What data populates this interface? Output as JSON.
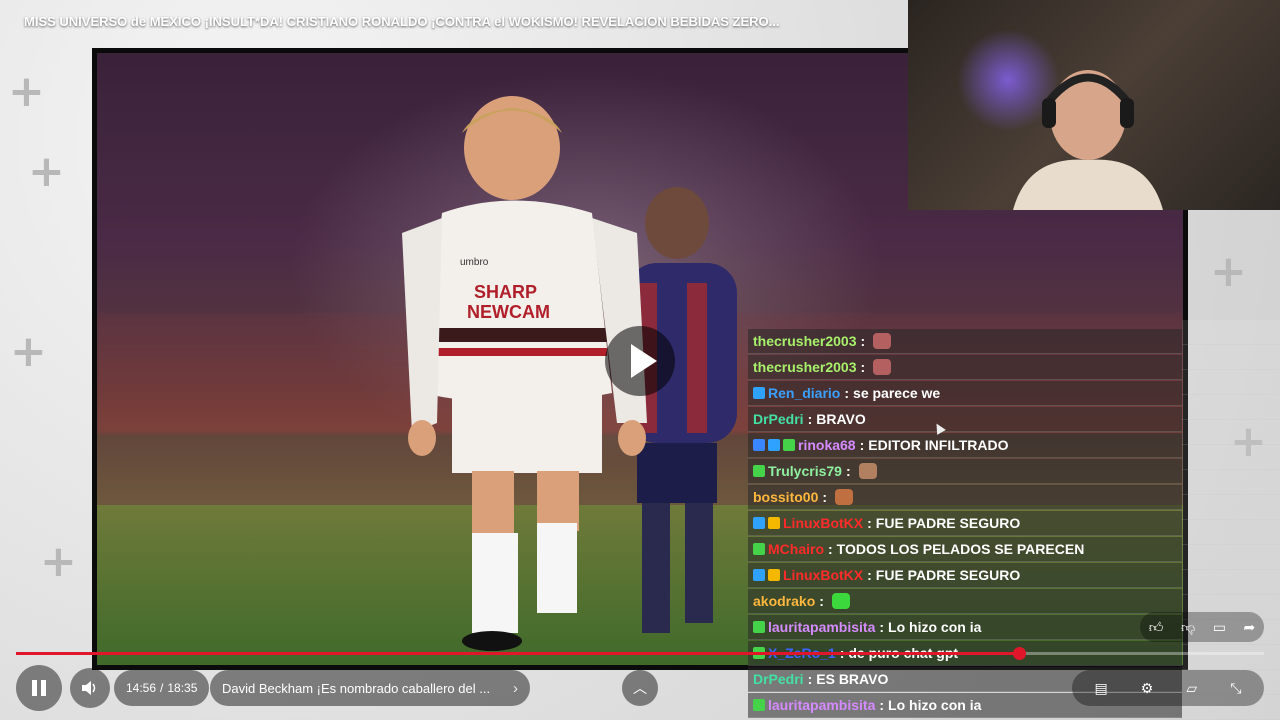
{
  "video": {
    "title": "MISS UNIVERSO de MEXICO ¡INSULT*DA! CRISTIANO RONALDO ¡CONTRA el WOKISMO! REVELACION BEBIDAS ZERO...",
    "kit_sponsor_line1": "SHARP",
    "kit_sponsor_line2": "NEWCAM",
    "kit_brand": "umbro"
  },
  "chat": {
    "messages": [
      {
        "user": "thecrusher2003",
        "user_color": "#a6f06a",
        "text": "",
        "badges": [],
        "emote": "#b46060"
      },
      {
        "user": "thecrusher2003",
        "user_color": "#a6f06a",
        "text": "",
        "badges": [],
        "emote": "#b46060"
      },
      {
        "user": "Ren_diario",
        "user_color": "#3aa0ff",
        "text": "se parece we",
        "badges": [
          "#2fa2ff"
        ],
        "emote": ""
      },
      {
        "user": "DrPedri",
        "user_color": "#43e0a4",
        "text": "BRAVO",
        "badges": [],
        "emote": ""
      },
      {
        "user": "rinoka68",
        "user_color": "#d58bff",
        "text": "EDITOR INFILTRADO",
        "badges": [
          "#3a86ff",
          "#2fa2ff",
          "#45d34a"
        ],
        "emote": ""
      },
      {
        "user": "Trulycris79",
        "user_color": "#8ef0a0",
        "text": "",
        "badges": [
          "#45d34a"
        ],
        "emote": "#b08060"
      },
      {
        "user": "bossito00",
        "user_color": "#ffb83d",
        "text": "",
        "badges": [],
        "emote": "#c07040"
      },
      {
        "user": "LinuxBotKX",
        "user_color": "#ff2a2a",
        "text": "FUE PADRE SEGURO",
        "badges": [
          "#2fa2ff",
          "#f4b800"
        ],
        "emote": ""
      },
      {
        "user": "MChairo",
        "user_color": "#ff2a2a",
        "text": "TODOS LOS PELADOS SE PARECEN",
        "badges": [
          "#45d34a"
        ],
        "emote": ""
      },
      {
        "user": "LinuxBotKX",
        "user_color": "#ff2a2a",
        "text": "FUE PADRE SEGURO",
        "badges": [
          "#2fa2ff",
          "#f4b800"
        ],
        "emote": ""
      },
      {
        "user": "akodrako",
        "user_color": "#ffb83d",
        "text": "",
        "badges": [],
        "emote": "#3bd93b"
      },
      {
        "user": "lauritapambisita",
        "user_color": "#d58bff",
        "text": "Lo hizo con ia",
        "badges": [
          "#45d34a"
        ],
        "emote": ""
      },
      {
        "user": "X_ZeRo_1",
        "user_color": "#3a66ff",
        "text": "de puro chat gpt",
        "badges": [
          "#45d34a"
        ],
        "emote": ""
      },
      {
        "user": "DrPedri",
        "user_color": "#43e0a4",
        "text": "ES BRAVO",
        "badges": [],
        "emote": ""
      },
      {
        "user": "lauritapambisita",
        "user_color": "#d58bff",
        "text": "Lo hizo con ia",
        "badges": [
          "#45d34a"
        ],
        "emote": ""
      }
    ]
  },
  "player": {
    "time_current": "14:56",
    "time_separator": "/",
    "time_total": "18:35",
    "progress": 0.8037,
    "chapter_title": "David Beckham ¡Es nombrado caballero del ...",
    "accent_color": "#e0162b"
  },
  "icons": {
    "pause": "pause-icon",
    "volume": "volume-icon",
    "chevron_right": "chevron-right-icon",
    "chevron_up": "chevron-up-icon",
    "play": "play-icon",
    "like": "thumbs-up-icon",
    "dislike": "thumbs-down-icon",
    "comment": "comment-icon",
    "share": "share-icon",
    "subtitles": "subtitles-icon",
    "settings": "gear-icon",
    "cast": "cast-icon",
    "fullscreen": "fullscreen-icon"
  }
}
